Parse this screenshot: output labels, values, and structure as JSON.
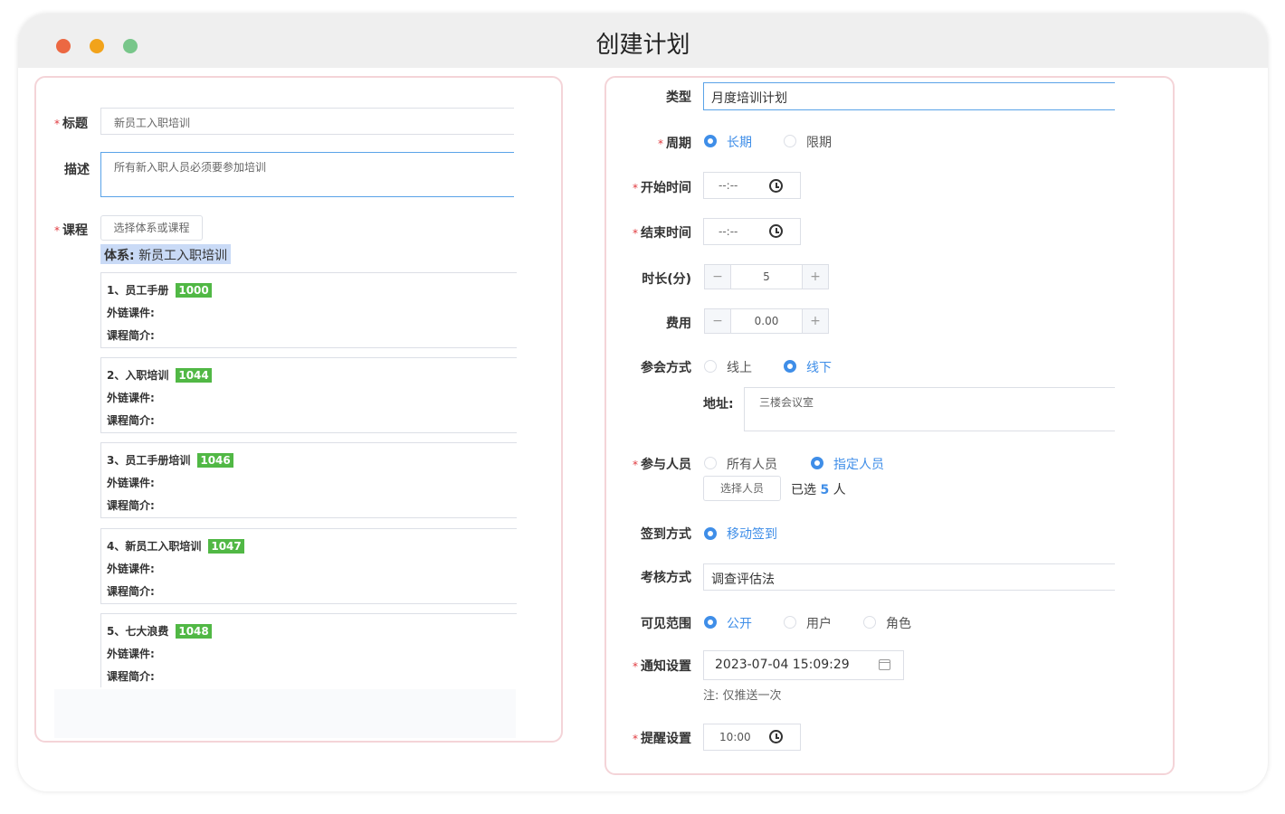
{
  "window": {
    "title": "创建计划"
  },
  "left": {
    "title_label": "标题",
    "title_value": "新员工入职培训",
    "desc_label": "描述",
    "desc_value": "所有新入职人员必须要参加培训",
    "course_label": "课程",
    "course_button": "选择体系或课程",
    "system_prefix": "体系:",
    "system_name": "新员工入职培训",
    "link_label": "外链课件:",
    "intro_label": "课程简介:",
    "courses": [
      {
        "name": "1、员工手册",
        "id": "1000"
      },
      {
        "name": "2、入职培训",
        "id": "1044"
      },
      {
        "name": "3、员工手册培训",
        "id": "1046"
      },
      {
        "name": "4、新员工入职培训",
        "id": "1047"
      },
      {
        "name": "5、七大浪费",
        "id": "1048"
      }
    ]
  },
  "right": {
    "type_label": "类型",
    "type_value": "月度培训计划",
    "period_label": "周期",
    "period_options": [
      "长期",
      "限期"
    ],
    "start_label": "开始时间",
    "start_value": "--:--",
    "end_label": "结束时间",
    "end_value": "--:--",
    "duration_label": "时长(分)",
    "duration_value": "5",
    "fee_label": "费用",
    "fee_value": "0.00",
    "minus": "−",
    "plus": "+",
    "attend_label": "参会方式",
    "attend_options": [
      "线上",
      "线下"
    ],
    "address_label": "地址:",
    "address_value": "三楼会议室",
    "people_label": "参与人员",
    "people_options": [
      "所有人员",
      "指定人员"
    ],
    "select_people_button": "选择人员",
    "selected_prefix": "已选",
    "selected_count": "5",
    "selected_suffix": "人",
    "signin_label": "签到方式",
    "signin_option": "移动签到",
    "assess_label": "考核方式",
    "assess_value": "调查评估法",
    "visible_label": "可见范围",
    "visible_options": [
      "公开",
      "用户",
      "角色"
    ],
    "notify_label": "通知设置",
    "notify_value": "2023-07-04 15:09:29",
    "notify_note": "注: 仅推送一次",
    "remind_label": "提醒设置",
    "remind_value": "10:00"
  },
  "colors": {
    "accent": "#3f8ee8",
    "tag_green": "#51b845",
    "required": "#e0393e",
    "panel_border": "#f4d4d8"
  }
}
